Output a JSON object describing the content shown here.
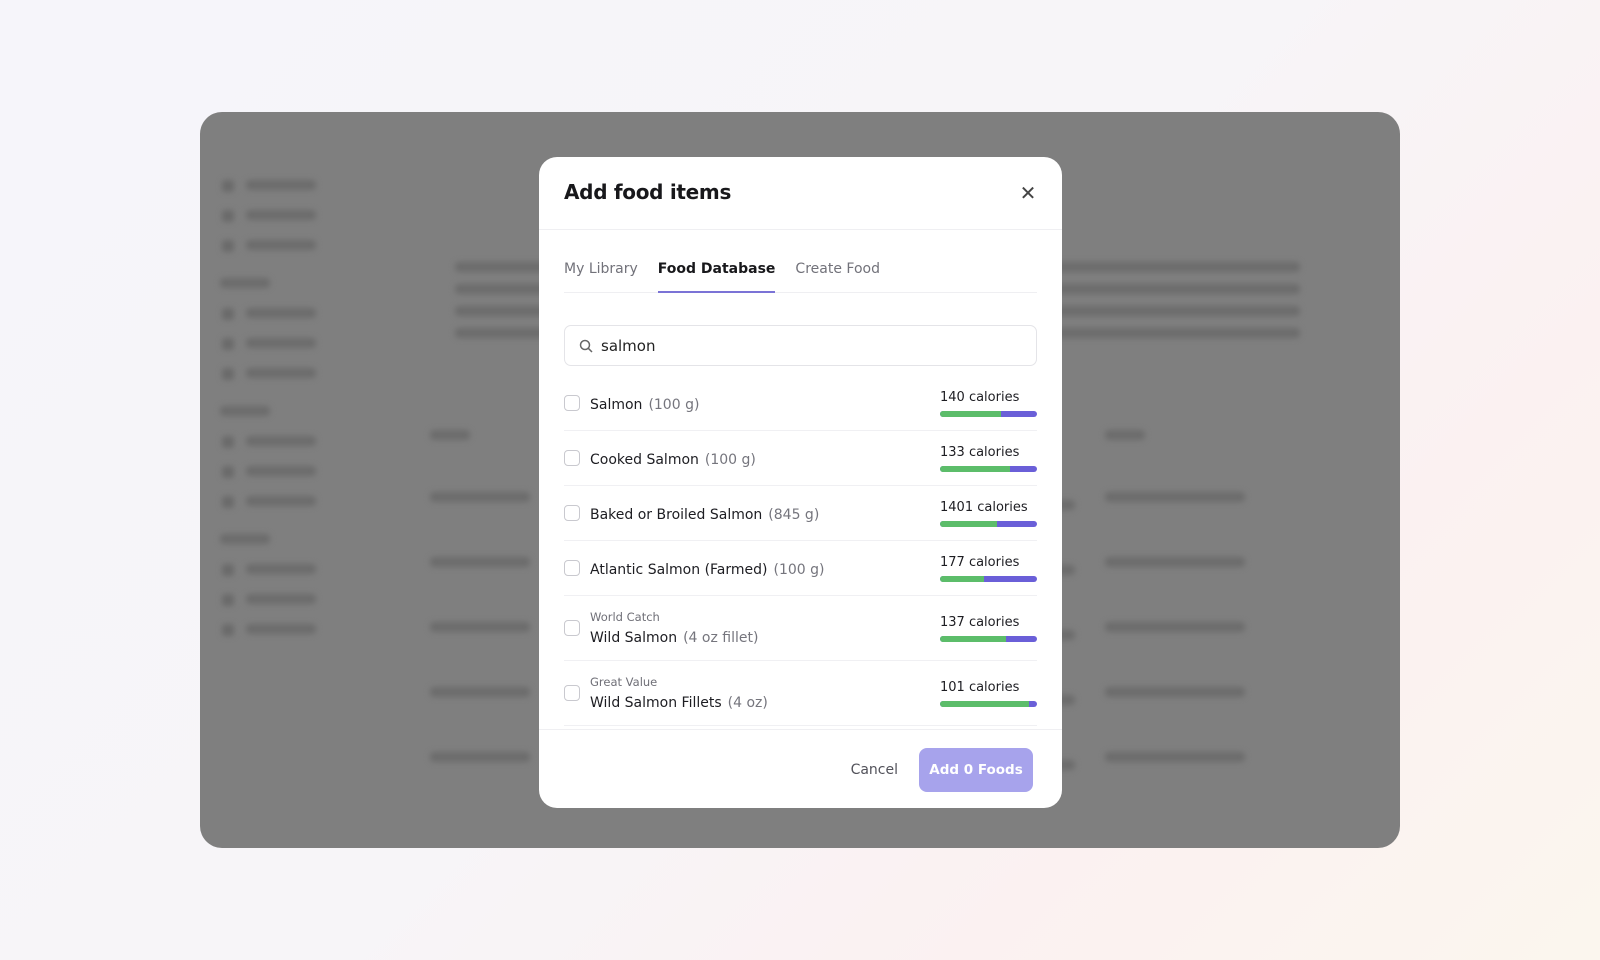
{
  "modal": {
    "title": "Add food items",
    "close_icon": "close-icon",
    "tabs": [
      {
        "label": "My Library"
      },
      {
        "label": "Food Database",
        "active": true
      },
      {
        "label": "Create Food"
      }
    ],
    "search": {
      "value": "salmon",
      "icon": "search-icon"
    },
    "items": [
      {
        "brand": "",
        "name": "Salmon",
        "serving": "(100 g)",
        "calories": "140 calories",
        "green_fraction": 0.63
      },
      {
        "brand": "",
        "name": "Cooked Salmon",
        "serving": "(100 g)",
        "calories": "133 calories",
        "green_fraction": 0.72
      },
      {
        "brand": "",
        "name": "Baked or Broiled Salmon",
        "serving": "(845 g)",
        "calories": "1401 calories",
        "green_fraction": 0.59
      },
      {
        "brand": "",
        "name": "Atlantic Salmon (Farmed)",
        "serving": "(100 g)",
        "calories": "177 calories",
        "green_fraction": 0.45
      },
      {
        "brand": "World Catch",
        "name": "Wild Salmon",
        "serving": "(4 oz fillet)",
        "calories": "137 calories",
        "green_fraction": 0.68
      },
      {
        "brand": "Great Value",
        "name": "Wild Salmon Fillets",
        "serving": "(4 oz)",
        "calories": "101 calories",
        "green_fraction": 0.92
      }
    ],
    "cancel_label": "Cancel",
    "add_label": "Add 0 Foods"
  },
  "colors": {
    "accent": "#7b73d6",
    "bar_green": "#5cbd6a",
    "bar_blue": "#6a5fd8",
    "add_button": "#a7a3ec"
  }
}
